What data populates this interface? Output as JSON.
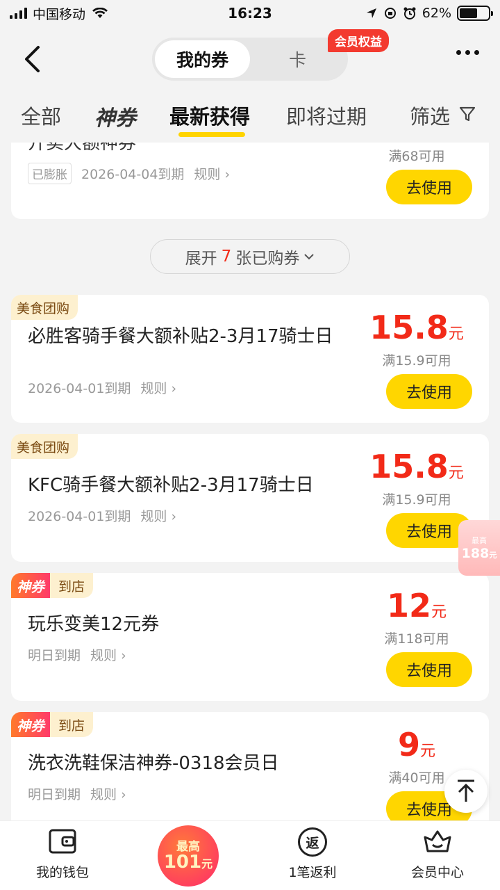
{
  "status_bar": {
    "carrier": "中国移动",
    "time": "16:23",
    "battery": "62%",
    "battery_level": 0.62
  },
  "top_nav": {
    "segment_coupons": "我的券",
    "segment_cards": "卡",
    "vip_badge": "会员权益"
  },
  "tabs": {
    "all": "全部",
    "shen": "神券",
    "latest": "最新获得",
    "expiring": "即将过期",
    "filter": "筛选"
  },
  "partial_card": {
    "title_fragment": "开卖大额神券",
    "expanded_label": "已膨胀",
    "expiry": "2026-04-04到期",
    "rule": "规则",
    "condition": "满68可用",
    "use": "去使用"
  },
  "expand": {
    "prefix": "展开",
    "count": "7",
    "suffix": "张已购券"
  },
  "coupons": [
    {
      "tag": "美食团购",
      "title": "必胜客骑手餐大额补贴2-3月17骑士日",
      "expiry": "2026-04-01到期",
      "rule": "规则",
      "amount": "15.8",
      "unit": "元",
      "condition": "满15.9可用",
      "use": "去使用"
    },
    {
      "tag": "美食团购",
      "title": "KFC骑手餐大额补贴2-3月17骑士日",
      "expiry": "2026-04-01到期",
      "rule": "规则",
      "amount": "15.8",
      "unit": "元",
      "condition": "满15.9可用",
      "use": "去使用"
    },
    {
      "shen_tag": "神券",
      "tag": "到店",
      "title": "玩乐变美12元券",
      "expiry": "明日到期",
      "rule": "规则",
      "amount": "12",
      "unit": "元",
      "condition": "满118可用",
      "use": "去使用"
    },
    {
      "shen_tag": "神券",
      "tag": "到店",
      "title": "洗衣洗鞋保洁神券-0318会员日",
      "expiry": "明日到期",
      "rule": "规则",
      "amount": "9",
      "unit": "元",
      "condition": "满40可用",
      "use": "去使用"
    }
  ],
  "float_promo": {
    "label": "最高",
    "amount": "188",
    "unit": "元"
  },
  "bottom_bar": {
    "wallet": "我的钱包",
    "promo_top": "最高",
    "promo_amount": "101",
    "promo_unit": "元",
    "rebate_icon": "返",
    "rebate": "1笔返利",
    "member": "会员中心"
  },
  "colors": {
    "accent_yellow": "#ffd600",
    "price_red": "#f22a18",
    "tag_bg": "#fdf0cf"
  }
}
